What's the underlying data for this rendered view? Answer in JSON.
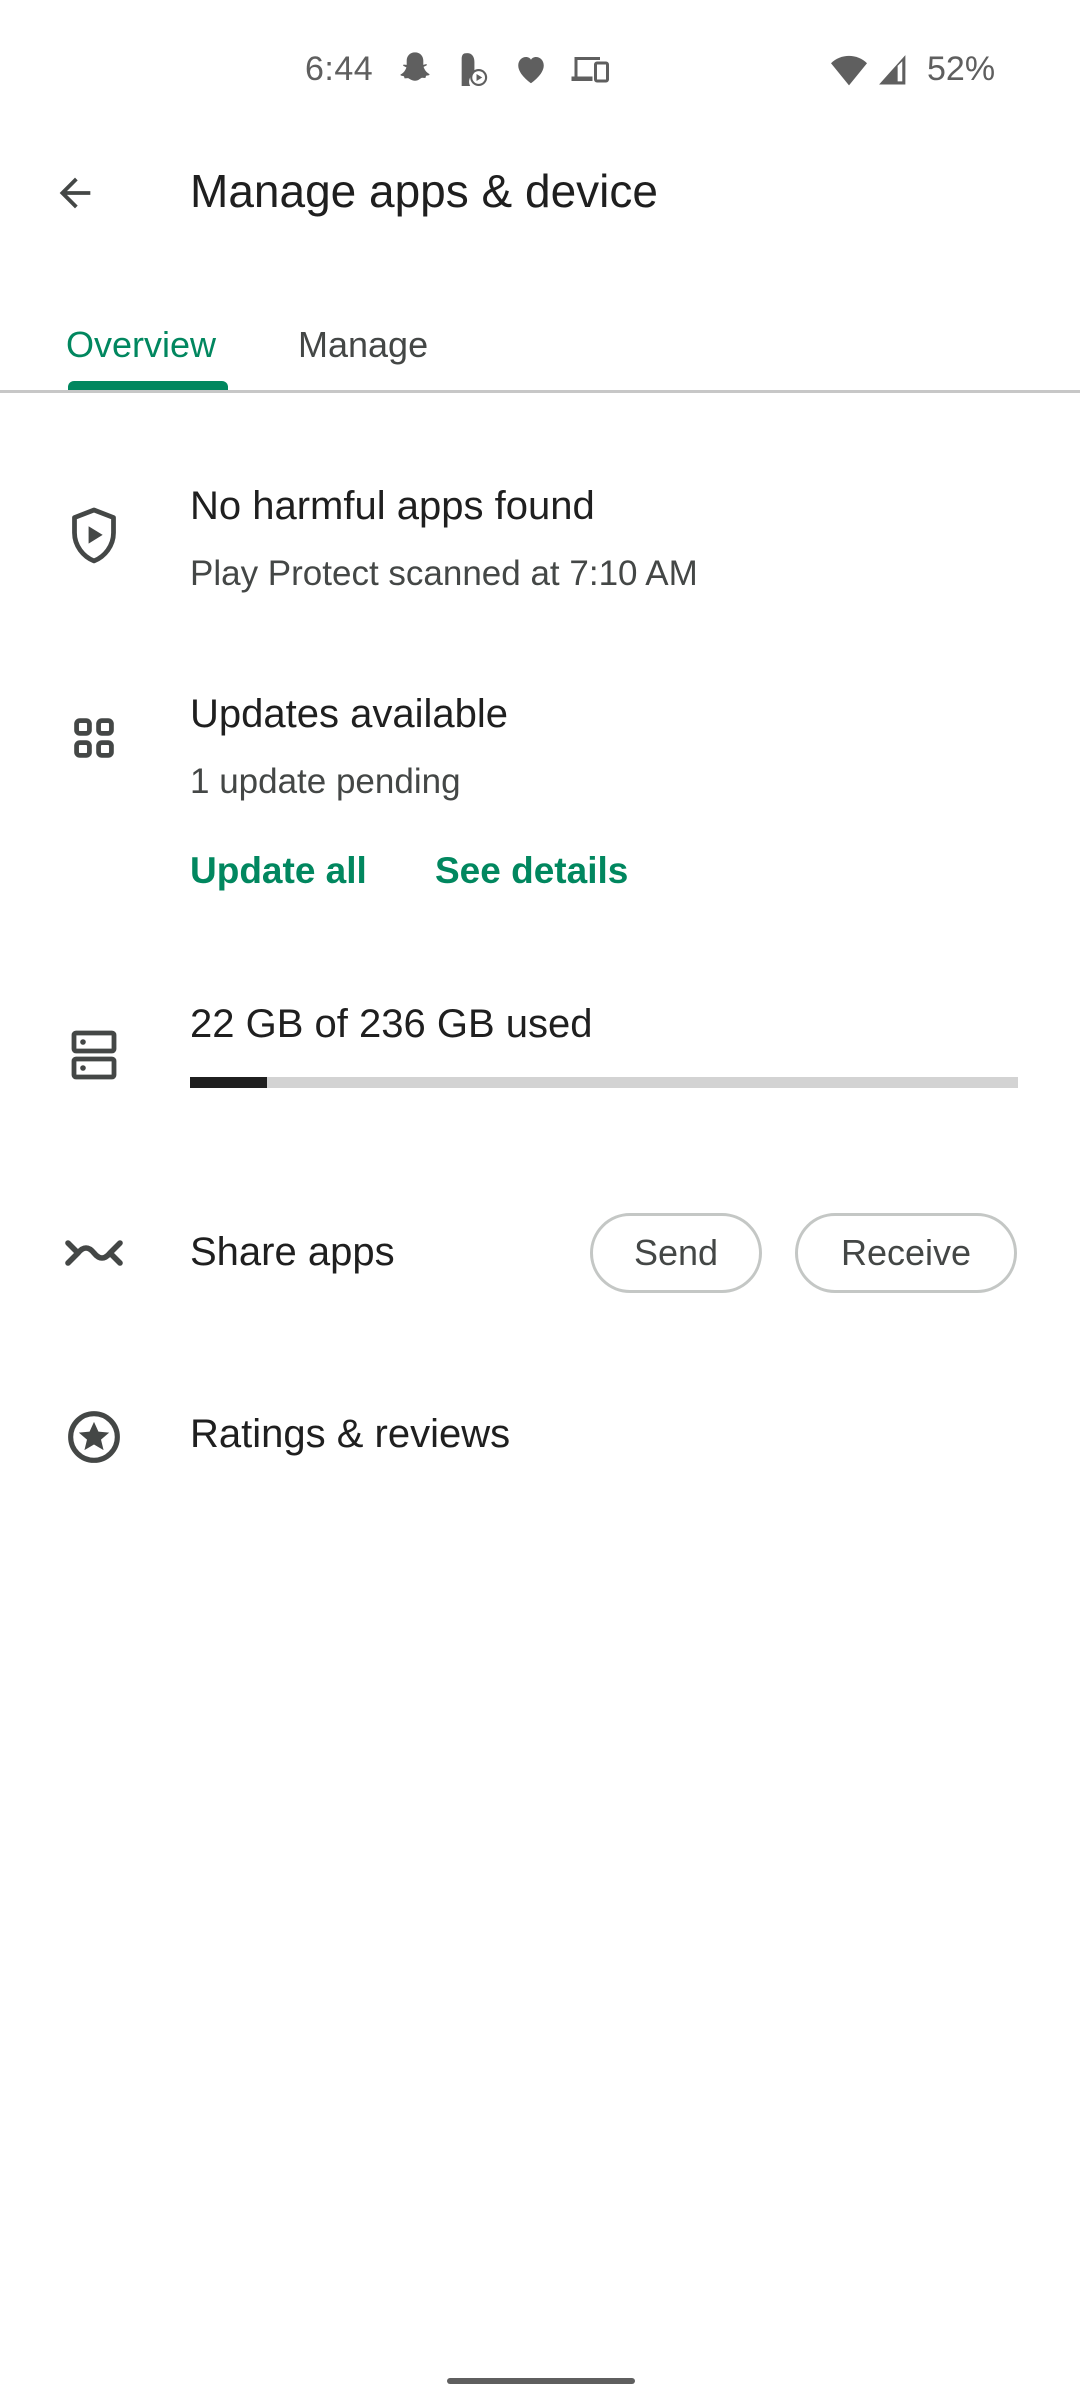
{
  "status_bar": {
    "time": "6:44",
    "notification_icons": [
      "snapchat-icon",
      "podcast-app-icon",
      "heart-icon",
      "devices-icon"
    ],
    "system_icons": [
      "wifi-icon",
      "cell-signal-icon"
    ],
    "battery": "52%"
  },
  "toolbar": {
    "back_icon": "arrow-back-icon",
    "title": "Manage apps & device"
  },
  "tabs": [
    {
      "label": "Overview",
      "selected": true
    },
    {
      "label": "Manage",
      "selected": false
    }
  ],
  "colors": {
    "accent": "#01875f",
    "text_primary": "#1f1f1f",
    "text_secondary": "#444746",
    "icon": "#444746",
    "divider": "#c7c7c7"
  },
  "overview": {
    "protect": {
      "icon": "play-protect-shield-icon",
      "title": "No harmful apps found",
      "subtitle": "Play Protect scanned at 7:10 AM"
    },
    "updates": {
      "icon": "apps-grid-icon",
      "title": "Updates available",
      "subtitle": "1 update pending",
      "update_all_label": "Update all",
      "see_details_label": "See details"
    },
    "storage": {
      "icon": "storage-icon",
      "label": "22 GB of 236 GB used",
      "used_gb": 22,
      "total_gb": 236,
      "used_fraction": 0.093
    },
    "share": {
      "icon": "share-apps-icon",
      "label": "Share apps",
      "send_label": "Send",
      "receive_label": "Receive"
    },
    "ratings": {
      "icon": "star-circle-icon",
      "label": "Ratings & reviews"
    }
  }
}
